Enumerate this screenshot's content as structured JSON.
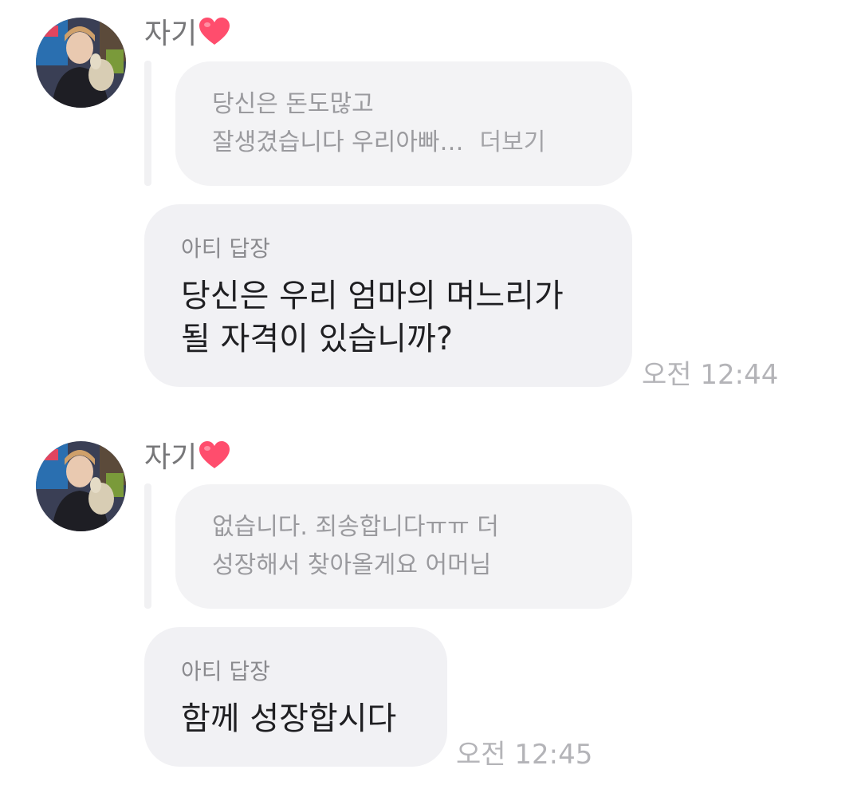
{
  "sender": {
    "name": "자기",
    "icon": "heart-icon",
    "heart_color": "#ff4d6d"
  },
  "messages": [
    {
      "quote": [
        "당신은 돈도많고",
        "잘생겼습니다 우리아빠…"
      ],
      "more_label": "더보기",
      "reply_label": "아티 답장",
      "reply": [
        "당신은 우리 엄마의 며느리가",
        "될 자격이 있습니까?"
      ],
      "time": "오전 12:44"
    },
    {
      "quote": [
        "없습니다. 죄송합니다ㅠㅠ 더",
        "성장해서 찾아올게요 어머님"
      ],
      "reply_label": "아티 답장",
      "reply": [
        "함께 성장합시다"
      ],
      "time": "오전 12:45"
    }
  ]
}
